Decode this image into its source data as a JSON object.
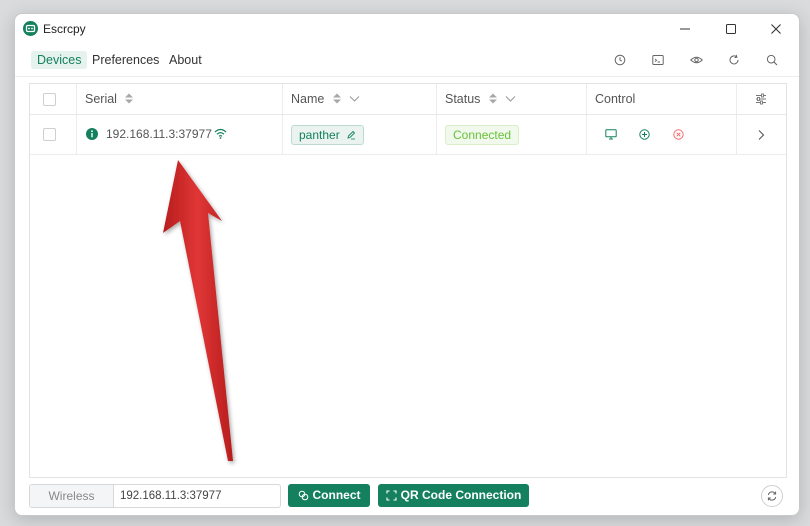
{
  "window": {
    "title": "Escrcpy",
    "controls": [
      "minimize-icon",
      "maximize-icon",
      "close-icon"
    ]
  },
  "menu": {
    "items": [
      {
        "label": "Devices",
        "active": true
      },
      {
        "label": "Preferences",
        "active": false
      },
      {
        "label": "About",
        "active": false
      }
    ],
    "toolbar_icons": [
      "clock-icon",
      "terminal-icon",
      "eye-icon",
      "refresh-icon",
      "search-icon"
    ]
  },
  "table": {
    "columns": {
      "serial": "Serial",
      "name": "Name",
      "status": "Status",
      "control": "Control"
    },
    "rows": [
      {
        "serial": "192.168.11.3:37977",
        "connection_icon": "wifi-icon",
        "name": "panther",
        "status": "Connected",
        "control_icons": [
          "monitor-icon",
          "plus-circle-icon",
          "close-circle-icon"
        ]
      }
    ]
  },
  "bottom": {
    "wireless_label": "Wireless",
    "address_value": "192.168.11.3:37977",
    "connect_label": "Connect",
    "qr_label": "QR Code Connection"
  },
  "colors": {
    "accent": "#14805e",
    "status_green": "#67c23a",
    "danger": "#f56c6c",
    "annotation_arrow": "#d42a2a"
  }
}
